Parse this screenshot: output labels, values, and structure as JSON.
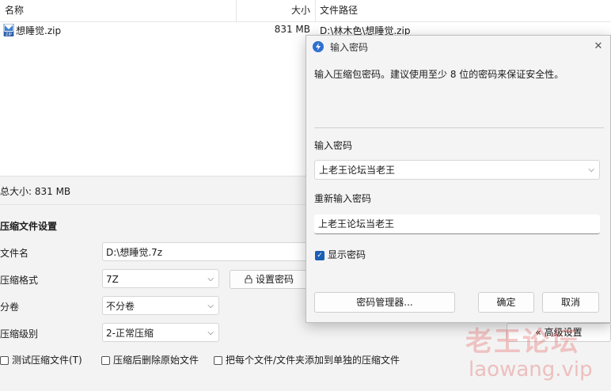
{
  "file_list": {
    "col_name": "名称",
    "col_size": "大小",
    "col_path": "文件路径",
    "rows": [
      {
        "name": "想睡觉.zip",
        "size": "831 MB",
        "path": "D:\\林木色\\想睡觉.zip",
        "icon": "zip-icon"
      }
    ]
  },
  "summary": {
    "total_size": "总大小: 831 MB"
  },
  "settings": {
    "section_title": "压缩文件设置",
    "filename_label": "文件名",
    "filename_value": "D:\\想睡觉.7z",
    "format_label": "压缩格式",
    "format_value": "7Z",
    "set_password_label": "设置密码",
    "volume_label": "分卷",
    "volume_value": "不分卷",
    "level_label": "压缩级别",
    "level_value": "2-正常压缩",
    "advanced_label": "« 高级设置",
    "checkbox_test": "测试压缩文件(T)",
    "checkbox_delete": "压缩后删除原始文件",
    "checkbox_separate": "把每个文件/文件夹添加到单独的压缩文件"
  },
  "dialog": {
    "title": "输入密码",
    "description": "输入压缩包密码。建议使用至少 8 位的密码来保证安全性。",
    "password_label": "输入密码",
    "password_value": "上老王论坛当老王",
    "reenter_label": "重新输入密码",
    "reenter_value": "上老王论坛当老王",
    "show_password_label": "显示密码",
    "show_password_checked": true,
    "manager_button": "密码管理器...",
    "ok_button": "确定",
    "cancel_button": "取消",
    "accent": "#1a5fb4"
  },
  "watermark": {
    "line1": "老王论坛",
    "line2": "laowang.vip"
  }
}
